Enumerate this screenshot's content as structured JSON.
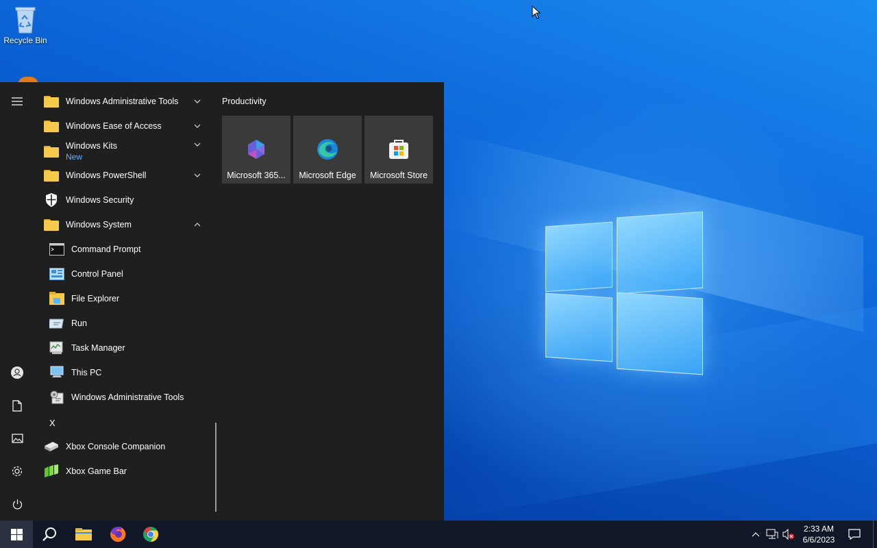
{
  "desktop": {
    "icons": [
      {
        "label": "Recycle Bin",
        "icon": "recycle-bin-icon"
      }
    ]
  },
  "start_menu": {
    "rail": [
      {
        "name": "expand",
        "icon": "hamburger-menu-icon"
      },
      {
        "name": "account",
        "icon": "user-account-icon"
      },
      {
        "name": "documents",
        "icon": "document-icon"
      },
      {
        "name": "pictures",
        "icon": "pictures-icon"
      },
      {
        "name": "settings",
        "icon": "gear-icon"
      },
      {
        "name": "power",
        "icon": "power-icon"
      }
    ],
    "apps": [
      {
        "label": "Windows Administrative Tools",
        "icon": "folder-icon",
        "chevron": "down"
      },
      {
        "label": "Windows Ease of Access",
        "icon": "folder-icon",
        "chevron": "down"
      },
      {
        "label": "Windows Kits",
        "sublabel": "New",
        "icon": "folder-icon",
        "chevron": "down"
      },
      {
        "label": "Windows PowerShell",
        "icon": "folder-icon",
        "chevron": "down"
      },
      {
        "label": "Windows Security",
        "icon": "shield-icon"
      },
      {
        "label": "Windows System",
        "icon": "folder-icon",
        "chevron": "up"
      },
      {
        "label": "Command Prompt",
        "icon": "command-prompt-icon"
      },
      {
        "label": "Control Panel",
        "icon": "control-panel-icon"
      },
      {
        "label": "File Explorer",
        "icon": "file-explorer-icon"
      },
      {
        "label": "Run",
        "icon": "run-icon"
      },
      {
        "label": "Task Manager",
        "icon": "task-manager-icon"
      },
      {
        "label": "This PC",
        "icon": "this-pc-icon"
      },
      {
        "label": "Windows Administrative Tools",
        "icon": "admin-tools-icon"
      },
      {
        "label": "Xbox Console Companion",
        "icon": "xbox-console-icon"
      },
      {
        "label": "Xbox Game Bar",
        "icon": "xbox-game-bar-icon"
      }
    ],
    "letter_header": "X",
    "tiles": {
      "group_title": "Productivity",
      "items": [
        {
          "label": "Microsoft 365...",
          "icon": "microsoft-365-icon"
        },
        {
          "label": "Microsoft Edge",
          "icon": "edge-icon"
        },
        {
          "label": "Microsoft Store",
          "icon": "store-icon"
        }
      ]
    }
  },
  "taskbar": {
    "pinned": [
      {
        "name": "start",
        "icon": "windows-logo-icon"
      },
      {
        "name": "search",
        "icon": "search-icon"
      },
      {
        "name": "file-explorer",
        "icon": "folder-icon"
      },
      {
        "name": "firefox",
        "icon": "firefox-icon"
      },
      {
        "name": "chrome",
        "icon": "chrome-icon"
      }
    ],
    "tray": {
      "icons": [
        "chevron-up-icon",
        "network-icon",
        "volume-muted-icon"
      ],
      "time": "2:33 AM",
      "date": "6/6/2023",
      "notification_icon": "action-center-icon"
    }
  },
  "colors": {
    "start_bg": "#1f1f1f",
    "tile_bg": "#3a3a3a",
    "taskbar_bg": "#101726",
    "folder": "#f7ca4e",
    "accent_sublabel": "#5fb2ff"
  }
}
